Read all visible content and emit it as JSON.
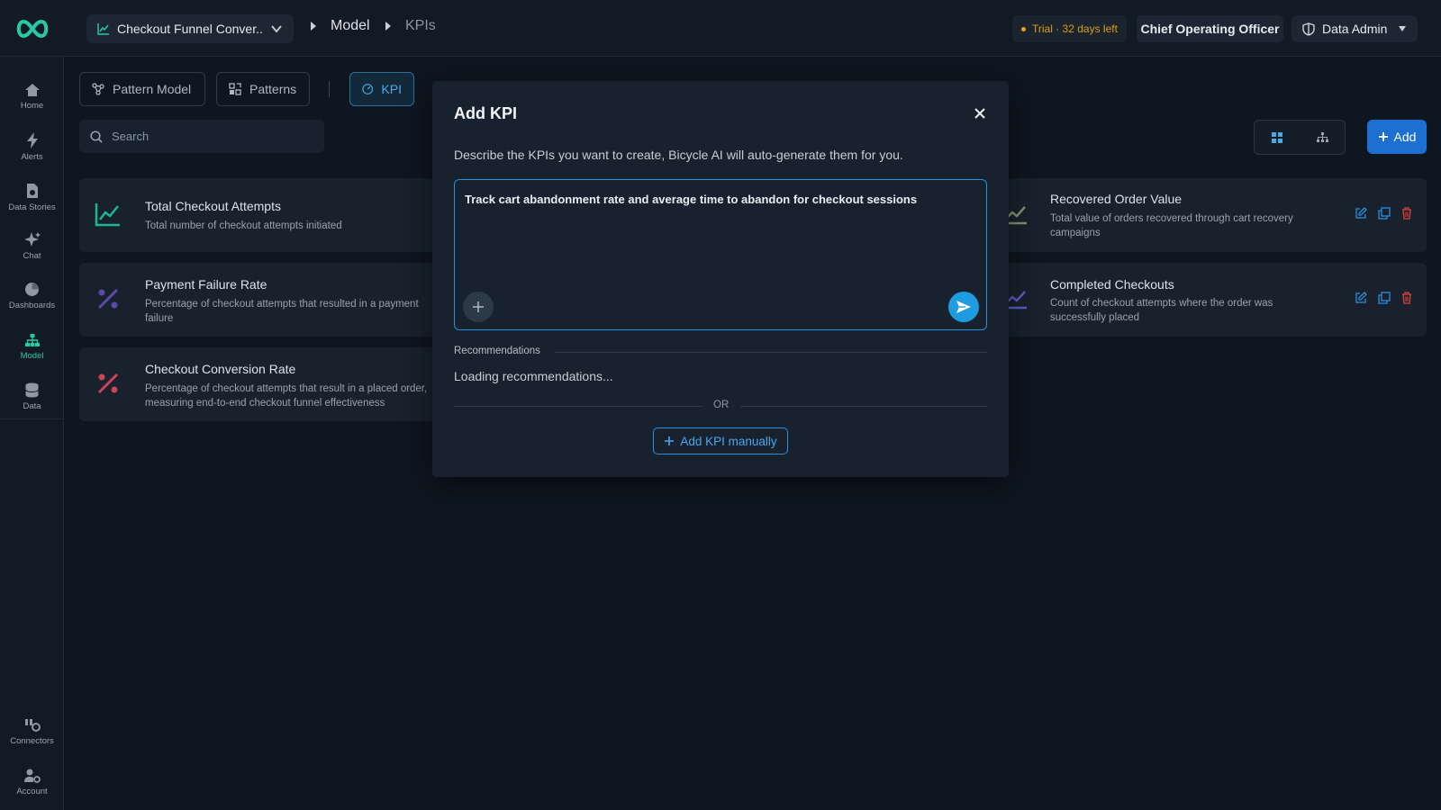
{
  "header": {
    "scope_label": "Checkout Funnel Conver...",
    "breadcrumbs": [
      "Model",
      "KPIs"
    ],
    "trial_text": "Trial · 32 days left",
    "role": "Chief Operating Officer",
    "admin_label": "Data Admin"
  },
  "sidebar": {
    "items": [
      {
        "label": "Home",
        "icon": "home-icon"
      },
      {
        "label": "Alerts",
        "icon": "bolt-icon"
      },
      {
        "label": "Data Stories",
        "icon": "story-icon"
      },
      {
        "label": "Chat",
        "icon": "sparkle-icon"
      },
      {
        "label": "Dashboards",
        "icon": "pie-icon"
      },
      {
        "label": "Model",
        "icon": "hierarchy-icon"
      },
      {
        "label": "Data",
        "icon": "database-icon"
      }
    ],
    "bottom_items": [
      {
        "label": "Connectors",
        "icon": "connector-icon"
      },
      {
        "label": "Account",
        "icon": "user-gear-icon"
      }
    ]
  },
  "tabs": [
    {
      "label": "Pattern Model"
    },
    {
      "label": "Patterns"
    },
    {
      "label": "KPI"
    }
  ],
  "search": {
    "placeholder": "Search"
  },
  "toolbar": {
    "add_label": "Add"
  },
  "kpi_cards": [
    {
      "title": "Total Checkout Attempts",
      "description": "Total number of checkout attempts initiated",
      "icon": "line-chart-icon",
      "color": "#1fb596"
    },
    {
      "title": "Payment Failure Rate",
      "description": "Percentage of checkout attempts that resulted in a payment failure",
      "icon": "percent-icon",
      "color": "#5a4aa8"
    },
    {
      "title": "Checkout Conversion Rate",
      "description": "Percentage of checkout attempts that result in a placed order, measuring end-to-end checkout funnel effectiveness",
      "icon": "percent-icon",
      "color": "#c8455a"
    },
    {
      "title": "Recovered Order Value",
      "description": "Total value of orders recovered through cart recovery campaigns",
      "icon": "line-chart-icon",
      "color": "#7e9270"
    },
    {
      "title": "Completed Checkouts",
      "description": "Count of checkout attempts where the order was successfully placed",
      "icon": "line-chart-icon",
      "color": "#5a5cc8"
    }
  ],
  "modal": {
    "title": "Add KPI",
    "description": "Describe the KPIs you want to create, Bicycle AI will auto-generate them for you.",
    "prompt_value": "Track cart abandonment rate and average time to abandon for checkout sessions",
    "recommendations_label": "Recommendations",
    "loading_text": "Loading recommendations...",
    "or_text": "OR",
    "manual_button": "Add KPI manually"
  },
  "colors": {
    "accent": "#27c9a4",
    "primary": "#1d6fd1",
    "trial": "#d4a017",
    "danger": "#d9413f"
  }
}
